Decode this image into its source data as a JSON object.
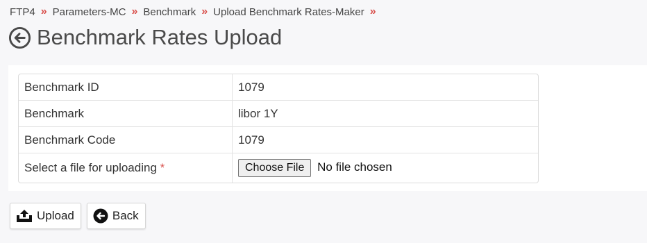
{
  "breadcrumb": [
    {
      "label": "FTP4"
    },
    {
      "label": "Parameters-MC"
    },
    {
      "label": "Benchmark"
    },
    {
      "label": "Upload Benchmark Rates-Maker"
    }
  ],
  "breadcrumb_separator": "»",
  "page": {
    "title": "Benchmark Rates Upload",
    "back_icon": "arrow-left-circle-icon"
  },
  "details": {
    "rows": [
      {
        "label": "Benchmark ID",
        "value": "1079"
      },
      {
        "label": "Benchmark",
        "value": "libor 1Y"
      },
      {
        "label": "Benchmark Code",
        "value": "1079"
      }
    ],
    "file_label": "Select a file for uploading",
    "required_marker": "*",
    "choose_file_label": "Choose File",
    "file_status": "No file chosen"
  },
  "actions": {
    "upload_label": "Upload",
    "upload_icon": "upload-tray-icon",
    "back_label": "Back",
    "back_icon": "arrow-left-circle-icon"
  },
  "colors": {
    "accent": "#d9534f",
    "background": "#f7f7f9",
    "panel": "#ffffff"
  }
}
